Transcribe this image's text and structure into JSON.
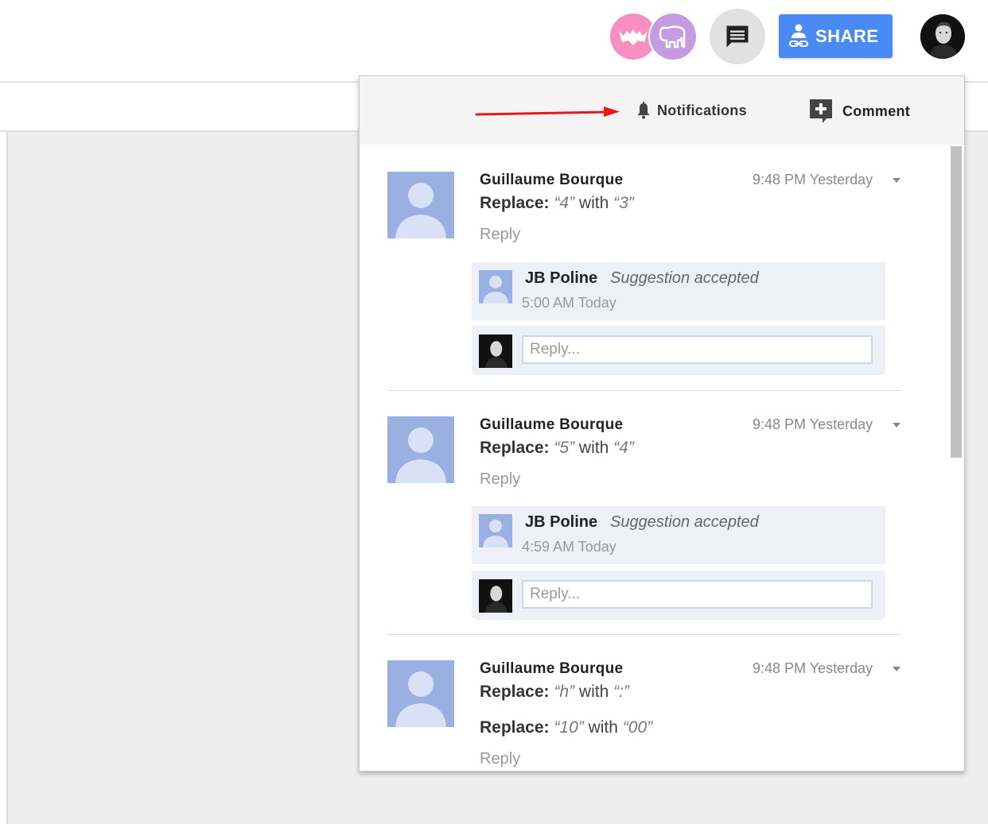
{
  "header": {
    "share_label": "SHARE"
  },
  "panel": {
    "notifications_label": "Notifications",
    "comment_label": "Comment",
    "threads": [
      {
        "author": "Guillaume Bourque",
        "time": "9:48 PM Yesterday",
        "changes": [
          {
            "prefix": "Replace:",
            "from": "“4”",
            "mid": " with ",
            "to": "“3”"
          }
        ],
        "reply_label": "Reply",
        "reply": {
          "name": "JB Poline",
          "status": "Suggestion accepted",
          "time": "5:00 AM Today"
        },
        "reply_placeholder": "Reply..."
      },
      {
        "author": "Guillaume Bourque",
        "time": "9:48 PM Yesterday",
        "changes": [
          {
            "prefix": "Replace:",
            "from": "“5”",
            "mid": " with ",
            "to": "“4”"
          }
        ],
        "reply_label": "Reply",
        "reply": {
          "name": "JB Poline",
          "status": "Suggestion accepted",
          "time": "4:59 AM Today"
        },
        "reply_placeholder": "Reply..."
      },
      {
        "author": "Guillaume Bourque",
        "time": "9:48 PM Yesterday",
        "changes": [
          {
            "prefix": "Replace:",
            "from": "“h”",
            "mid": " with ",
            "to": "“:”"
          },
          {
            "prefix": "Replace:",
            "from": "“10”",
            "mid": " with ",
            "to": "“00”"
          }
        ],
        "reply_label": "Reply"
      }
    ]
  },
  "colors": {
    "share_blue": "#4a8af4",
    "annotation_arrow": "#e8181a",
    "avatar_placeholder": "#9bb0e2",
    "collaborator_pink": "#f78fc0",
    "collaborator_purple": "#c59be2"
  },
  "icons": [
    "collaborator-bat-icon",
    "collaborator-elephant-icon",
    "comments-icon",
    "share-person-link-icon",
    "bell-icon",
    "add-comment-icon",
    "caret-down-icon",
    "default-avatar-icon"
  ]
}
